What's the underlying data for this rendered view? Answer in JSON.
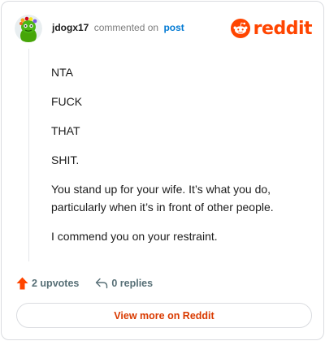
{
  "header": {
    "username": "jdogx17",
    "action_text": "commented on",
    "post_link": "post",
    "brand": "reddit"
  },
  "comment": {
    "paragraphs": [
      "NTA",
      "FUCK",
      "THAT",
      "SHIT.",
      "You stand up for your wife. It’s what you do, particularly when it’s in front of other people.",
      "I commend you on your restraint."
    ]
  },
  "actions": {
    "upvotes": "2 upvotes",
    "replies": "0 replies"
  },
  "footer": {
    "view_more": "View more on Reddit"
  },
  "colors": {
    "brand": "#ff4500",
    "link": "#0079d3",
    "view_more_text": "#d93a00",
    "muted": "#576f76"
  },
  "icons": [
    "avatar-icon",
    "reddit-snoo-icon",
    "upvote-arrow-icon",
    "reply-arrow-icon"
  ]
}
